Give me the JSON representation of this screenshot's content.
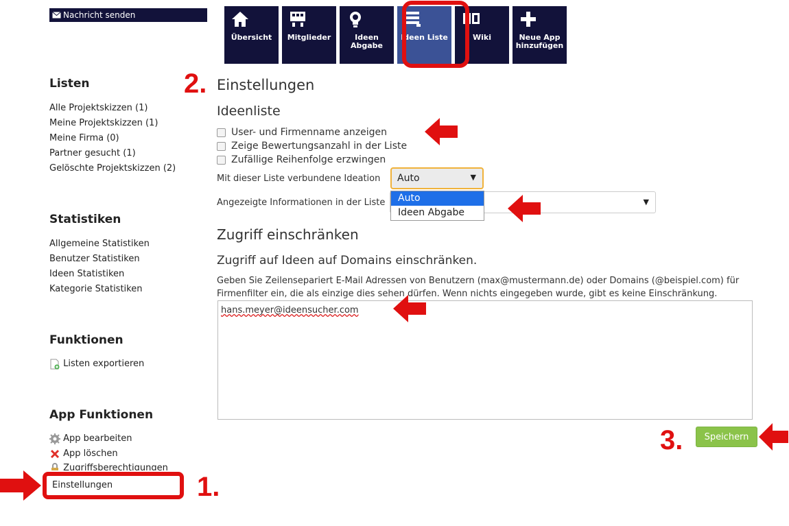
{
  "top": {
    "message_button": "Nachricht senden",
    "nav": [
      {
        "label": "Übersicht",
        "icon": "home-icon"
      },
      {
        "label": "Mitglieder",
        "icon": "members-icon"
      },
      {
        "label": "Ideen\nAbgabe",
        "icon": "lightbulb-icon"
      },
      {
        "label": "Ideen Liste",
        "icon": "list-icon"
      },
      {
        "label": "Wiki",
        "icon": "book-icon"
      },
      {
        "label": "Neue App\nhinzufügen",
        "icon": "plus-icon"
      }
    ]
  },
  "sidebar": {
    "listen_heading": "Listen",
    "listen": [
      "Alle Projektskizzen (1)",
      "Meine Projektskizzen (1)",
      "Meine Firma (0)",
      "Partner gesucht (1)",
      "Gelöschte Projektskizzen (2)"
    ],
    "statistiken_heading": "Statistiken",
    "statistiken": [
      "Allgemeine Statistiken",
      "Benutzer Statistiken",
      "Ideen Statistiken",
      "Kategorie Statistiken"
    ],
    "funktionen_heading": "Funktionen",
    "export": "Listen exportieren",
    "app_heading": "App Funktionen",
    "app_edit": "App bearbeiten",
    "app_delete": "App löschen",
    "access": "Zugriffsberechtigungen",
    "settings": "Einstellungen"
  },
  "main": {
    "title": "Einstellungen",
    "ideenliste": "Ideenliste",
    "checkboxes": [
      "User- und Firmenname anzeigen",
      "Zeige Bewertungsanzahl in der Liste",
      "Zufällige Reihenfolge erzwingen"
    ],
    "ideation_label": "Mit dieser Liste verbundene Ideation",
    "ideation_value": "Auto",
    "ideation_options": [
      "Auto",
      "Ideen Abgabe"
    ],
    "info_label": "Angezeigte Informationen in der Liste",
    "access_heading": "Zugriff einschränken",
    "access_sub": "Zugriff auf Ideen auf Domains einschränken.",
    "access_desc": "Geben Sie Zeilensepariert E-Mail Adressen von Benutzern (max@mustermann.de) oder Domains (@beispiel.com) für Firmenfilter ein, die als einzige dies sehen dürfen. Wenn nichts eingegeben wurde, gibt es keine Einschränkung.",
    "email_value": "hans.meyer@ideensucher.com",
    "save": "Speichern"
  },
  "steps": {
    "one": "1.",
    "two": "2.",
    "three": "3."
  },
  "colors": {
    "nav_bg": "#12123a",
    "nav_active": "#3b5296",
    "annotation_red": "#e01010",
    "save_green": "#8bc34a",
    "select_highlight": "#1e6fe8"
  }
}
